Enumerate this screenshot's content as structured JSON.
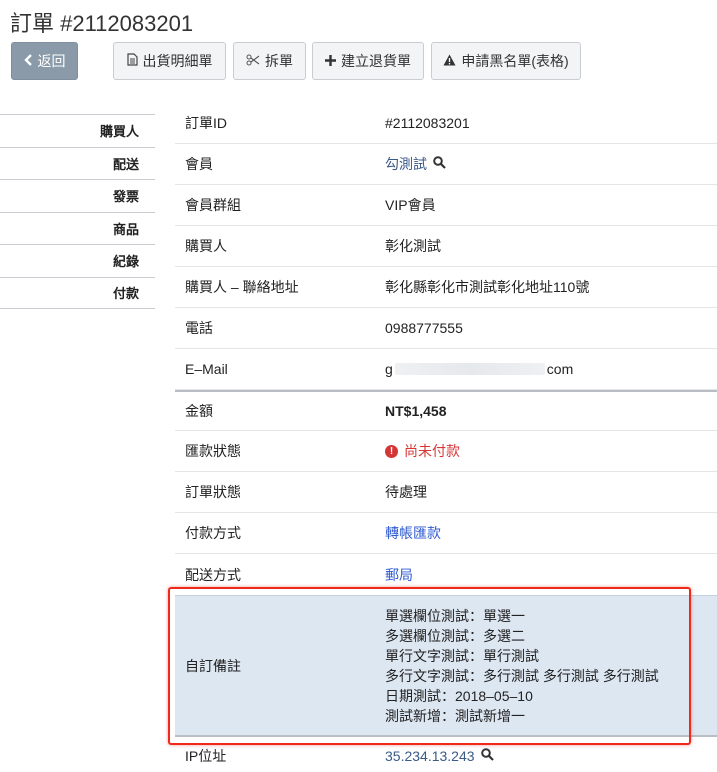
{
  "page": {
    "title": "訂單 #2112083201"
  },
  "toolbar": {
    "back_label": "返回",
    "detail_label": "出貨明細單",
    "split_label": "拆單",
    "return_label": "建立退貨單",
    "blacklist_label": "申請黑名單(表格)"
  },
  "side_nav": {
    "items": [
      "購買人",
      "配送",
      "發票",
      "商品",
      "紀錄",
      "付款"
    ]
  },
  "details": {
    "order_id": {
      "label": "訂單ID",
      "value": "#2112083201"
    },
    "member": {
      "label": "會員",
      "value": "勾測試"
    },
    "member_group": {
      "label": "會員群組",
      "value": "VIP會員"
    },
    "buyer": {
      "label": "購買人",
      "value": "彰化測試"
    },
    "address": {
      "label": "購買人 – 聯絡地址",
      "value": "彰化縣彰化市測試彰化地址110號"
    },
    "phone": {
      "label": "電話",
      "value": "0988777555"
    },
    "email": {
      "label": "E–Mail",
      "value_prefix": "g",
      "value_suffix": "com"
    },
    "amount": {
      "label": "金額",
      "value": "NT$1,458"
    },
    "remit_status": {
      "label": "匯款狀態",
      "value": "尚未付款"
    },
    "order_status": {
      "label": "訂單狀態",
      "value": "待處理"
    },
    "payment_method": {
      "label": "付款方式",
      "value": "轉帳匯款"
    },
    "shipping_method": {
      "label": "配送方式",
      "value": "郵局"
    },
    "custom_note": {
      "label": "自訂備註",
      "lines": [
        "單選欄位測試：單選一",
        "多選欄位測試：多選二",
        "單行文字測試：單行測試",
        "多行文字測試：多行測試 多行測試 多行測試",
        "日期測試：2018–05–10",
        "測試新增：測試新增一"
      ]
    },
    "ip": {
      "label": "IP位址",
      "value": "35.234.13.243"
    }
  },
  "colors": {
    "link": "#2f5bd1",
    "danger": "#d43636",
    "note_background": "#dde7f2",
    "highlight_border": "#ee2b1b"
  },
  "icons": {
    "back": "chevron-left-icon",
    "detail": "document-icon",
    "split": "scissors-icon",
    "return": "plus-icon",
    "blacklist": "warning-icon",
    "search": "magnifier-icon",
    "alert": "exclamation-circle-icon"
  }
}
